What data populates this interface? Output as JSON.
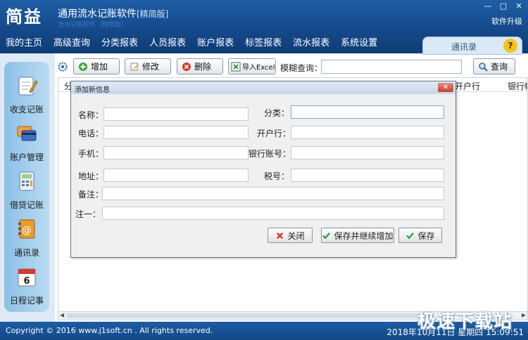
{
  "app": {
    "logo": "简益",
    "title": "通用流水记账软件",
    "edition": "[精简版]",
    "ghost_subtitle": "流水记账软件（精简版）",
    "upgrade": "软件升级",
    "window_controls": [
      "—",
      "□",
      "✕"
    ]
  },
  "menu": [
    "我的主页",
    "高级查询",
    "分类报表",
    "人员报表",
    "账户报表",
    "标签报表",
    "流水报表",
    "系统设置"
  ],
  "contacts_tab": {
    "label": "通讯录",
    "help": "?"
  },
  "sidebar": [
    {
      "label": "收支记账",
      "icon": "notepad-pencil-icon"
    },
    {
      "label": "账户管理",
      "icon": "credit-cards-icon"
    },
    {
      "label": "借贷记账",
      "icon": "calculator-icon"
    },
    {
      "label": "通讯录",
      "icon": "address-book-icon"
    },
    {
      "label": "日程记事",
      "icon": "calendar-icon"
    }
  ],
  "toolbar": {
    "add": "增加",
    "edit": "修改",
    "delete": "删除",
    "import": "导入Excel",
    "search_label": "模糊查询：",
    "search_value": "",
    "search_btn": "查询"
  },
  "grid": {
    "headers": [
      "分",
      "开户行",
      "银行帐"
    ]
  },
  "dialog": {
    "title": "添加新信息",
    "close": "✕",
    "fields": {
      "name": {
        "label": "名称：",
        "value": ""
      },
      "category": {
        "label": "分类：",
        "value": ""
      },
      "phone": {
        "label": "电话：",
        "value": ""
      },
      "bank": {
        "label": "开户行：",
        "value": ""
      },
      "mobile": {
        "label": "手机：",
        "value": ""
      },
      "account": {
        "label": "银行账号：",
        "value": ""
      },
      "address": {
        "label": "地址：",
        "value": ""
      },
      "tax": {
        "label": "税号：",
        "value": ""
      },
      "remark": {
        "label": "备注：",
        "value": ""
      },
      "note1": {
        "label": "注一：",
        "value": ""
      }
    },
    "buttons": {
      "close": "关闭",
      "save_continue": "保存并继续增加",
      "save": "保存"
    }
  },
  "status": {
    "copyright": "Copyright © 2016 www.j1soft.cn . All rights reserved.",
    "datetime": "2018年10月11日  星期四 15:09:51"
  },
  "watermark": "极速下载站",
  "colors": {
    "title_bg": "#1a56a0",
    "menu_bg": "#13458a",
    "sidebar_bg": "#a6d0ef",
    "status_bg": "#1a56a0"
  }
}
